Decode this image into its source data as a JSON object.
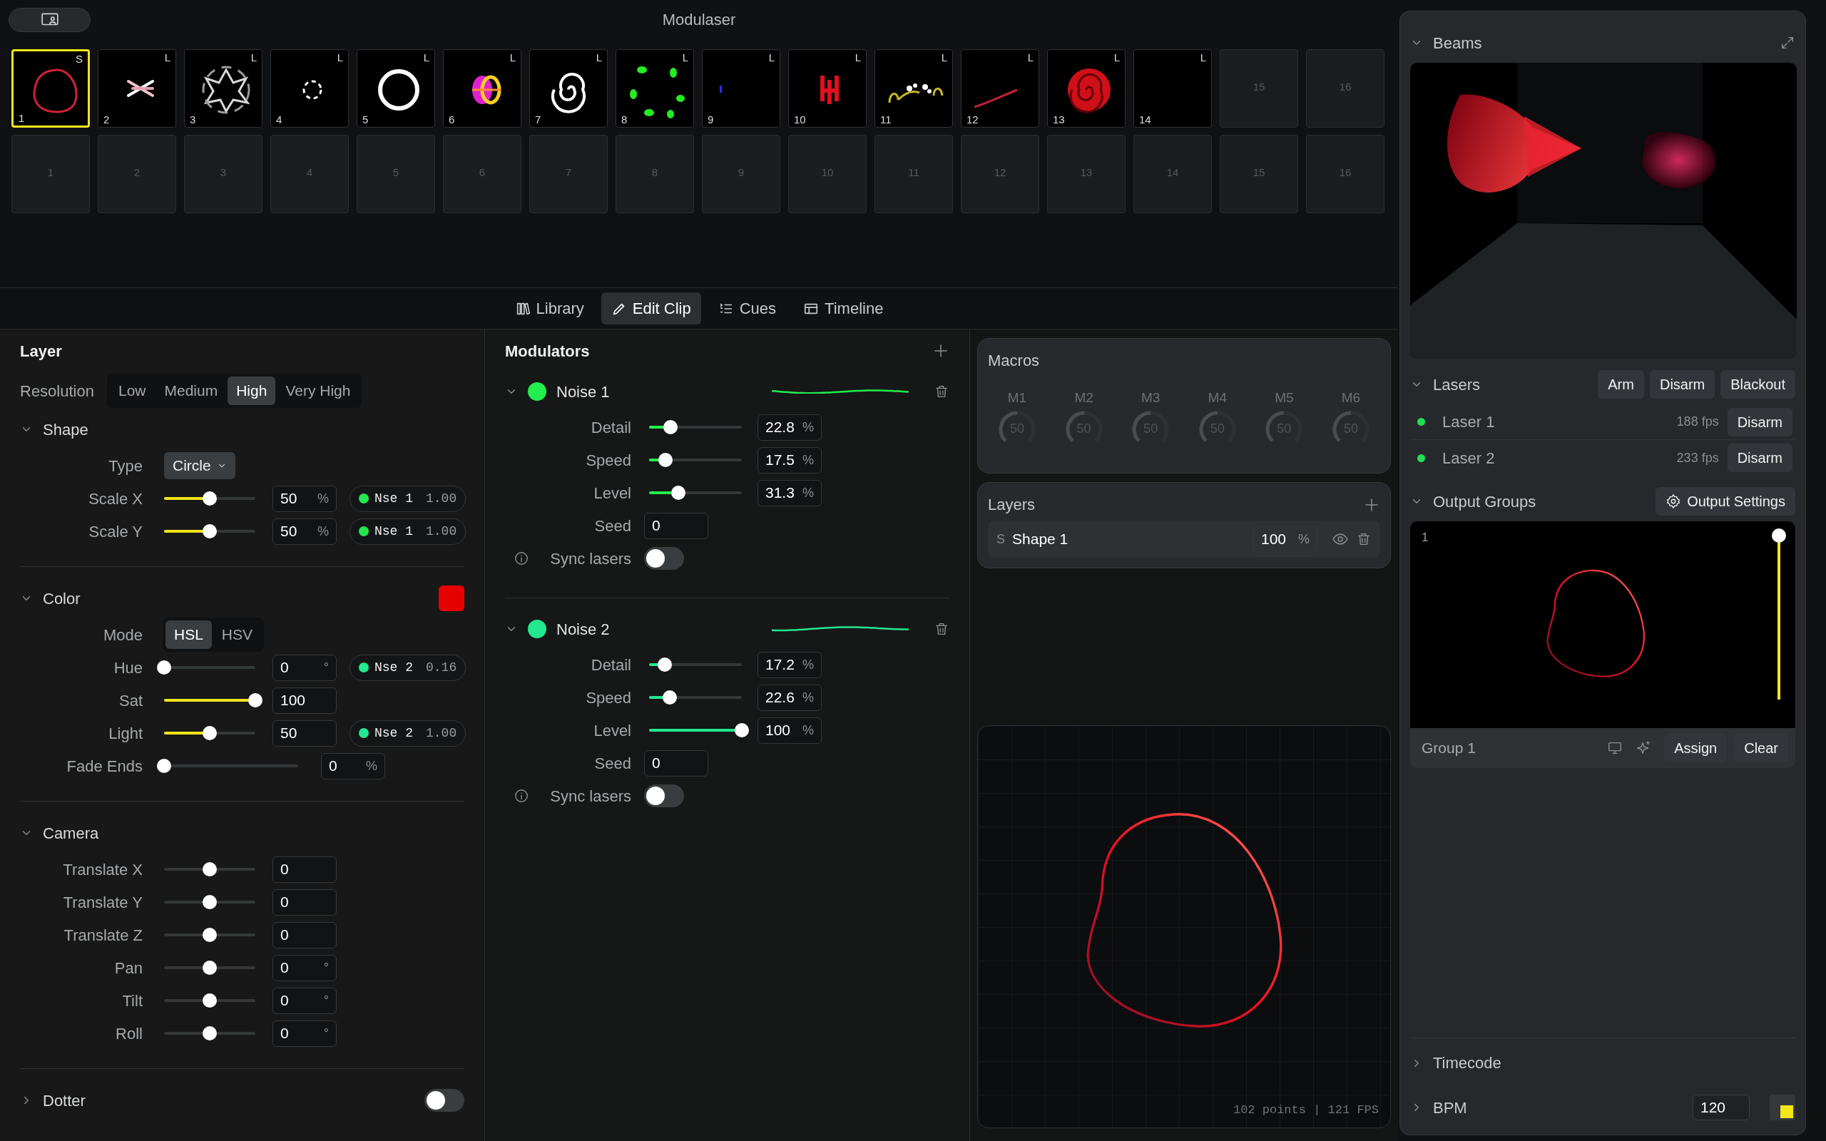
{
  "window": {
    "title": "Modulaser"
  },
  "clip_rows": [
    {
      "clips": [
        {
          "number": "1",
          "badge": "S",
          "kind": "clip",
          "selected": true
        },
        {
          "number": "2",
          "badge": "L",
          "kind": "clip",
          "selected": false
        },
        {
          "number": "3",
          "badge": "L",
          "kind": "clip",
          "selected": false
        },
        {
          "number": "4",
          "badge": "L",
          "kind": "clip",
          "selected": false
        },
        {
          "number": "5",
          "badge": "L",
          "kind": "clip",
          "selected": false
        },
        {
          "number": "6",
          "badge": "L",
          "kind": "clip",
          "selected": false
        },
        {
          "number": "7",
          "badge": "L",
          "kind": "clip",
          "selected": false
        },
        {
          "number": "8",
          "badge": "L",
          "kind": "clip",
          "selected": false
        },
        {
          "number": "9",
          "badge": "L",
          "kind": "clip",
          "selected": false
        },
        {
          "number": "10",
          "badge": "L",
          "kind": "clip",
          "selected": false
        },
        {
          "number": "11",
          "badge": "L",
          "kind": "clip",
          "selected": false
        },
        {
          "number": "12",
          "badge": "L",
          "kind": "clip",
          "selected": false
        },
        {
          "number": "13",
          "badge": "L",
          "kind": "clip",
          "selected": false
        },
        {
          "number": "14",
          "badge": "L",
          "kind": "clip",
          "selected": false
        },
        {
          "number": "15",
          "kind": "empty",
          "selected": false
        },
        {
          "number": "16",
          "kind": "empty",
          "selected": false
        }
      ]
    },
    {
      "clips": [
        {
          "number": "1",
          "kind": "empty",
          "selected": false
        },
        {
          "number": "2",
          "kind": "empty",
          "selected": false
        },
        {
          "number": "3",
          "kind": "empty",
          "selected": false
        },
        {
          "number": "4",
          "kind": "empty",
          "selected": false
        },
        {
          "number": "5",
          "kind": "empty",
          "selected": false
        },
        {
          "number": "6",
          "kind": "empty",
          "selected": false
        },
        {
          "number": "7",
          "kind": "empty",
          "selected": false
        },
        {
          "number": "8",
          "kind": "empty",
          "selected": false
        },
        {
          "number": "9",
          "kind": "empty",
          "selected": false
        },
        {
          "number": "10",
          "kind": "empty",
          "selected": false
        },
        {
          "number": "11",
          "kind": "empty",
          "selected": false
        },
        {
          "number": "12",
          "kind": "empty",
          "selected": false
        },
        {
          "number": "13",
          "kind": "empty",
          "selected": false
        },
        {
          "number": "14",
          "kind": "empty",
          "selected": false
        },
        {
          "number": "15",
          "kind": "empty",
          "selected": false
        },
        {
          "number": "16",
          "kind": "empty",
          "selected": false
        }
      ]
    }
  ],
  "tabs": [
    {
      "label": "Library",
      "selected": false
    },
    {
      "label": "Edit Clip",
      "selected": true
    },
    {
      "label": "Cues",
      "selected": false
    },
    {
      "label": "Timeline",
      "selected": false
    }
  ],
  "layer": {
    "title": "Layer",
    "resolution": {
      "label": "Resolution",
      "options": [
        {
          "label": "Low",
          "selected": false
        },
        {
          "label": "Medium",
          "selected": false
        },
        {
          "label": "High",
          "selected": true
        },
        {
          "label": "Very High",
          "selected": false
        }
      ]
    },
    "sections": [
      {
        "title": "Shape",
        "expanded": true,
        "rows": [
          {
            "kind": "select",
            "label": "Type",
            "value": "Circle"
          },
          {
            "kind": "slider",
            "label": "Scale X",
            "level": 0.5,
            "value": "50",
            "unit": "%",
            "modulation": {
              "name": "Nse 1",
              "value": "1.00",
              "color": "#22e84e"
            }
          },
          {
            "kind": "slider",
            "label": "Scale Y",
            "level": 0.5,
            "value": "50",
            "unit": "%",
            "modulation": {
              "name": "Nse 1",
              "value": "1.00",
              "color": "#22e84e"
            }
          }
        ]
      },
      {
        "title": "Color",
        "expanded": true,
        "color": "#e60000",
        "rows": [
          {
            "kind": "segmented",
            "label": "Mode",
            "options": [
              {
                "label": "HSL",
                "selected": true
              },
              {
                "label": "HSV",
                "selected": false
              }
            ]
          },
          {
            "kind": "slider",
            "label": "Hue",
            "level": 0,
            "value": "0",
            "unit": "°",
            "modulation": {
              "name": "Nse 2",
              "value": "0.16",
              "color": "#22e88f"
            }
          },
          {
            "kind": "slider",
            "label": "Sat",
            "level": 1,
            "value": "100"
          },
          {
            "kind": "slider",
            "label": "Light",
            "level": 0.5,
            "value": "50",
            "modulation": {
              "name": "Nse 2",
              "value": "1.00",
              "color": "#22e88f"
            }
          },
          {
            "kind": "wide-slider",
            "label": "Fade Ends",
            "level": 0,
            "value": "0",
            "unit": "%"
          }
        ]
      },
      {
        "title": "Camera",
        "expanded": true,
        "rows": [
          {
            "kind": "bipolar",
            "label": "Translate X",
            "level": 0.5,
            "value": "0"
          },
          {
            "kind": "bipolar",
            "label": "Translate Y",
            "level": 0.5,
            "value": "0"
          },
          {
            "kind": "bipolar",
            "label": "Translate Z",
            "level": 0.5,
            "value": "0"
          },
          {
            "kind": "bipolar",
            "label": "Pan",
            "level": 0.5,
            "value": "0",
            "unit": "°"
          },
          {
            "kind": "bipolar",
            "label": "Tilt",
            "level": 0.5,
            "value": "0",
            "unit": "°"
          },
          {
            "kind": "bipolar",
            "label": "Roll",
            "level": 0.5,
            "value": "0",
            "unit": "°"
          }
        ]
      },
      {
        "title": "Dotter",
        "expanded": false,
        "toggle": {
          "on": false
        }
      }
    ]
  },
  "modulators": {
    "title": "Modulators",
    "items": [
      {
        "name": "Noise 1",
        "color": "#22ee4e",
        "expanded": true,
        "params": [
          {
            "label": "Detail",
            "level": 0.228,
            "value": "22.8",
            "unit": "%"
          },
          {
            "label": "Speed",
            "level": 0.175,
            "value": "17.5",
            "unit": "%"
          },
          {
            "label": "Level",
            "level": 0.313,
            "value": "31.3",
            "unit": "%"
          }
        ],
        "seed": {
          "label": "Seed",
          "value": "0"
        },
        "sync": {
          "label": "Sync lasers",
          "on": false
        }
      },
      {
        "name": "Noise 2",
        "color": "#22e88f",
        "expanded": true,
        "params": [
          {
            "label": "Detail",
            "level": 0.172,
            "value": "17.2",
            "unit": "%"
          },
          {
            "label": "Speed",
            "level": 0.226,
            "value": "22.6",
            "unit": "%"
          },
          {
            "label": "Level",
            "level": 1,
            "value": "100",
            "unit": "%"
          }
        ],
        "seed": {
          "label": "Seed",
          "value": "0"
        },
        "sync": {
          "label": "Sync lasers",
          "on": false
        }
      }
    ]
  },
  "macros": {
    "title": "Macros",
    "disabled": true,
    "knobs": [
      {
        "label": "M1",
        "value": "50"
      },
      {
        "label": "M2",
        "value": "50"
      },
      {
        "label": "M3",
        "value": "50"
      },
      {
        "label": "M4",
        "value": "50"
      },
      {
        "label": "M5",
        "value": "50"
      },
      {
        "label": "M6",
        "value": "50"
      }
    ]
  },
  "layers": {
    "title": "Layers",
    "items": [
      {
        "badge": "S",
        "name": "Shape 1",
        "value": "100",
        "unit": "%"
      }
    ]
  },
  "preview": {
    "stats": "102 points | 121 FPS"
  },
  "sidebar": {
    "beams": {
      "title": "Beams",
      "expanded": true,
      "kind": "picture"
    },
    "lasers": {
      "title": "Lasers",
      "expanded": true,
      "buttons": [
        "Arm",
        "Disarm",
        "Blackout"
      ],
      "items": [
        {
          "name": "Laser 1",
          "fps": "188 fps",
          "color": "#22dd55",
          "button": "Disarm"
        },
        {
          "name": "Laser 2",
          "fps": "233 fps",
          "color": "#22dd55",
          "button": "Disarm"
        }
      ]
    },
    "output_groups": {
      "title": "Output Groups",
      "expanded": true,
      "button": "Output Settings",
      "groups": [
        {
          "number": "1",
          "name": "Group 1",
          "level": 1,
          "buttons": [
            "Assign",
            "Clear"
          ]
        }
      ]
    },
    "timecode": {
      "title": "Timecode",
      "expanded": false
    },
    "bpm": {
      "title": "BPM",
      "expanded": false,
      "value": "120",
      "beat_on": true
    }
  }
}
